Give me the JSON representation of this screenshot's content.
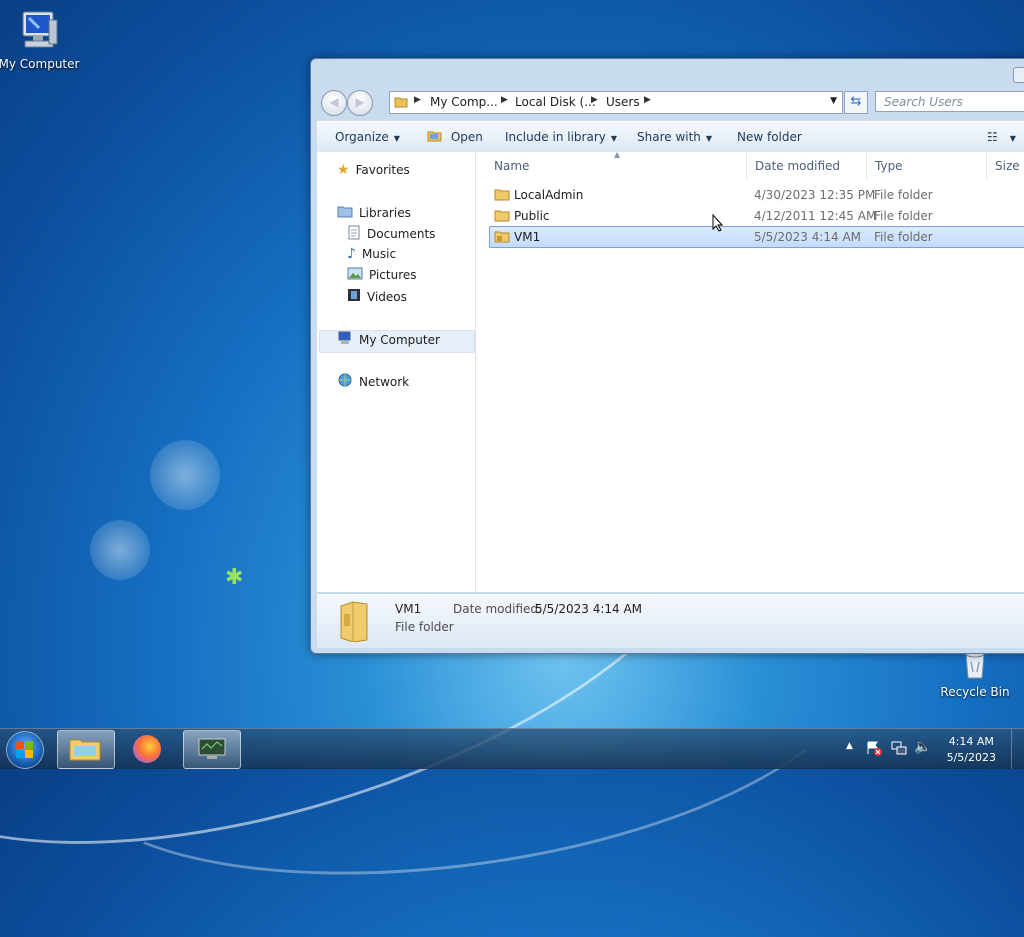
{
  "desktop": {
    "icons": [
      {
        "label": "My Computer"
      },
      {
        "label": "Recycle Bin"
      }
    ]
  },
  "window": {
    "breadcrumb": [
      "My Comp...",
      "Local Disk (...",
      "Users"
    ],
    "search_placeholder": "Search Users",
    "toolbar": {
      "organize": "Organize",
      "open": "Open",
      "include": "Include in library",
      "share": "Share with",
      "new_folder": "New folder"
    },
    "nav": {
      "favorites": "Favorites",
      "libraries": "Libraries",
      "documents": "Documents",
      "music": "Music",
      "pictures": "Pictures",
      "videos": "Videos",
      "computer": "My Computer",
      "network": "Network"
    },
    "columns": {
      "name": "Name",
      "date": "Date modified",
      "type": "Type",
      "size": "Size"
    },
    "files": [
      {
        "name": "LocalAdmin",
        "date": "4/30/2023 12:35 PM",
        "type": "File folder"
      },
      {
        "name": "Public",
        "date": "4/12/2011 12:45 AM",
        "type": "File folder"
      },
      {
        "name": "VM1",
        "date": "5/5/2023 4:14 AM",
        "type": "File folder"
      }
    ],
    "details": {
      "name": "VM1",
      "date_label": "Date modified:",
      "date_value": "5/5/2023 4:14 AM",
      "type": "File folder"
    }
  },
  "taskbar": {
    "time": "4:14 AM",
    "date": "5/5/2023"
  }
}
